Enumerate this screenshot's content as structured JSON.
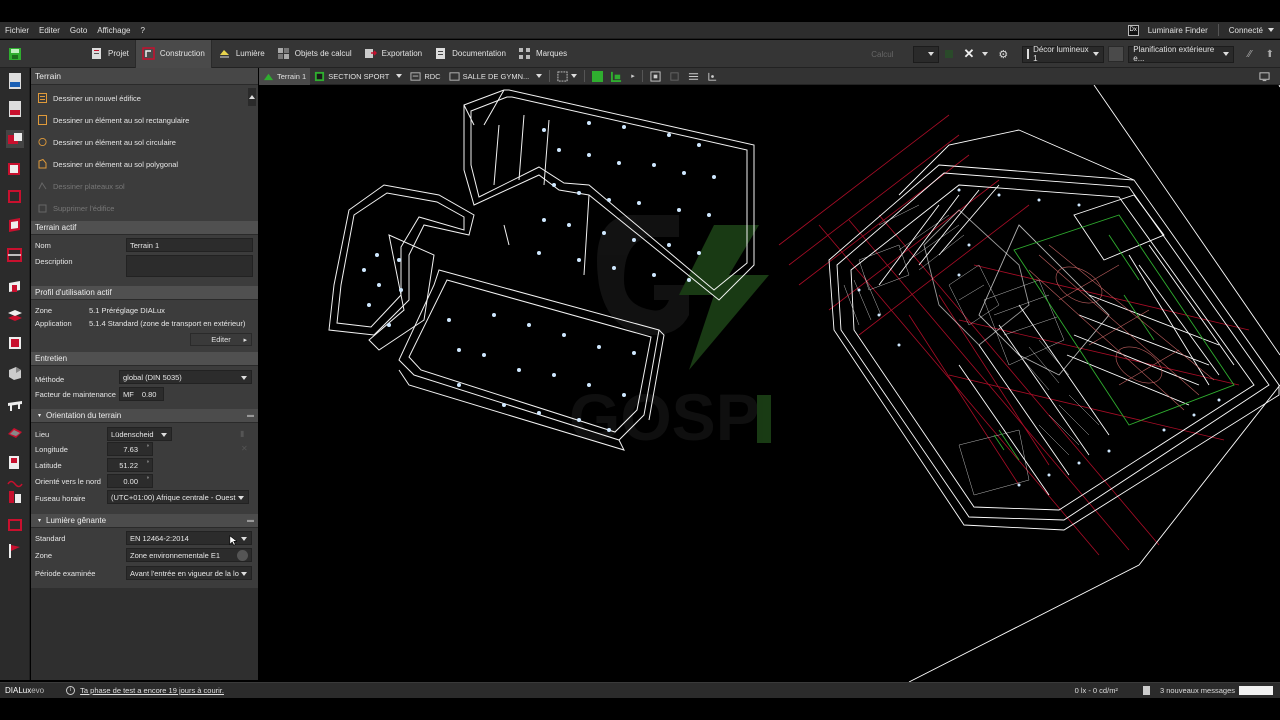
{
  "menu": {
    "items": [
      "Fichier",
      "Editer",
      "Goto",
      "Affichage",
      "?"
    ],
    "luminaire_finder": "Luminaire Finder",
    "lf_badge": "Dx",
    "connecte": "Connecté"
  },
  "ribbon": {
    "tabs": [
      "Projet",
      "Construction",
      "Lumière",
      "Objets de calcul",
      "Exportation",
      "Documentation",
      "Marques"
    ],
    "calcul": "Calcul",
    "decor": "Décor lumineux 1",
    "planification": "Planification extérieure e..."
  },
  "viewbar": {
    "terrain": "Terrain 1",
    "section": "SECTION SPORT",
    "rdc": "RDC",
    "salle": "SALLE DE GYMN..."
  },
  "panel": {
    "title": "Terrain",
    "tools": [
      "Dessiner un nouvel édifice",
      "Dessiner un élément au sol rectangulaire",
      "Dessiner un élément au sol circulaire",
      "Dessiner un élément au sol polygonal",
      "Dessiner plateaux sol",
      "Supprimer l'édifice"
    ],
    "terrain_actif": {
      "header": "Terrain actif",
      "nom_label": "Nom",
      "nom_value": "Terrain 1",
      "description_label": "Description",
      "description_value": ""
    },
    "profil": {
      "header": "Profil d'utilisation actif",
      "zone_label": "Zone",
      "zone_value": "5.1 Préréglage DIALux",
      "application_label": "Application",
      "application_value": "5.1.4 Standard (zone de transport en extérieur)",
      "editer": "Editer"
    },
    "entretien": {
      "header": "Entretien",
      "methode_label": "Méthode",
      "methode_value": "global (DIN 5035)",
      "facteur_label": "Facteur de maintenance",
      "mf": "MF",
      "facteur_value": "0.80"
    },
    "orientation": {
      "header": "Orientation du terrain",
      "lieu_label": "Lieu",
      "lieu_value": "Lüdenscheid",
      "longitude_label": "Longitude",
      "longitude_value": "7.63",
      "latitude_label": "Latitude",
      "latitude_value": "51.22",
      "nord_label": "Orienté vers le nord",
      "nord_value": "0.00",
      "fuseau_label": "Fuseau horaire",
      "fuseau_value": "(UTC+01:00) Afrique centrale - Ouest"
    },
    "lumiere": {
      "header": "Lumière gênante",
      "standard_label": "Standard",
      "standard_value": "EN 12464-2:2014",
      "zone_label": "Zone",
      "zone_value": "Zone environnementale E1",
      "periode_label": "Période examinée",
      "periode_value": "Avant l'entrée en vigueur de la lo"
    }
  },
  "status": {
    "brand_a": "DIALux",
    "brand_b": "evo",
    "trial": "Ta phase de test a encore 19 jours à courir.",
    "lux": "0 lx - 0 cd/m²",
    "messages": "3 nouveaux messages"
  },
  "colors": {
    "accent_green": "#2fae2f",
    "panel_bg": "#3c3c3c",
    "header_bg": "#505050",
    "wire": "#ffffff",
    "grid_red": "#c8102e"
  }
}
